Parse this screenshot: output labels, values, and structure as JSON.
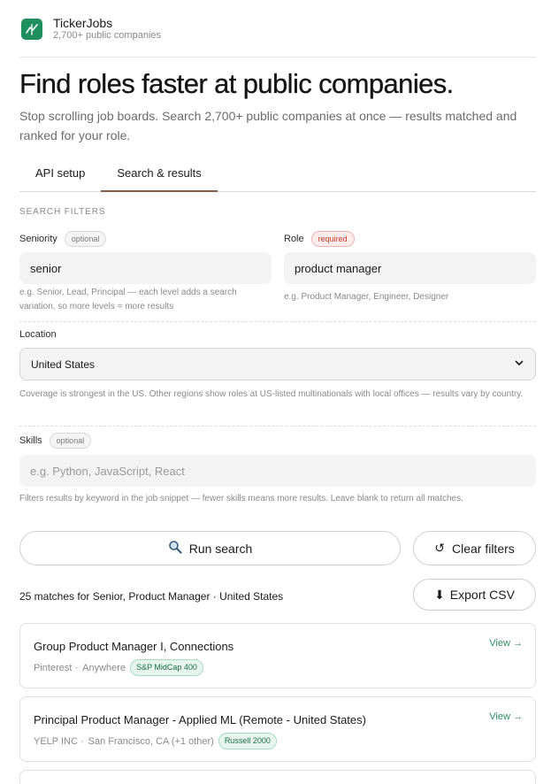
{
  "brand": {
    "name": "TickerJobs",
    "subtitle": "2,700+ public companies",
    "logo_icon": "chart-line-icon",
    "accent": "#1f8f5f"
  },
  "hero": {
    "title": "Find roles faster at public companies.",
    "subtitle": "Stop scrolling job boards. Search 2,700+ public companies at once — results matched and ranked for your role."
  },
  "tabs": [
    {
      "label": "API setup",
      "active": false
    },
    {
      "label": "Search & results",
      "active": true
    }
  ],
  "filters": {
    "section_label": "SEARCH FILTERS",
    "seniority": {
      "label": "Seniority",
      "tag": "optional",
      "value": "senior",
      "hint": "e.g. Senior, Lead, Principal — each level adds a search variation, so more levels = more results"
    },
    "role": {
      "label": "Role",
      "tag": "required",
      "value": "product manager",
      "hint": "e.g. Product Manager, Engineer, Designer"
    },
    "location": {
      "label": "Location",
      "value": "United States",
      "hint": "Coverage is strongest in the US. Other regions show roles at US-listed multinationals with local offices — results vary by country."
    },
    "skills": {
      "label": "Skills",
      "tag": "optional",
      "placeholder": "e.g. Python, JavaScript, React",
      "hint": "Filters results by keyword in the job snippet — fewer skills means more results. Leave blank to return all matches."
    }
  },
  "actions": {
    "run_label": "Run search",
    "run_icon": "magnifier-icon",
    "clear_label": "Clear filters",
    "clear_glyph": "↺",
    "export_label": "Export CSV",
    "export_glyph": "⬇"
  },
  "results": {
    "summary": "25 matches for Senior, Product Manager · United States",
    "items": [
      {
        "title": "Group Product Manager I, Connections",
        "company": "Pinterest ·",
        "location": "Anywhere",
        "index_badge": "S&P MidCap 400",
        "view_label": "View →"
      },
      {
        "title": "Principal Product Manager - Applied ML (Remote - United States)",
        "company": "YELP INC ·",
        "location": "San Francisco, CA (+1 other)",
        "index_badge": "Russell 2000",
        "view_label": "View →"
      }
    ]
  }
}
